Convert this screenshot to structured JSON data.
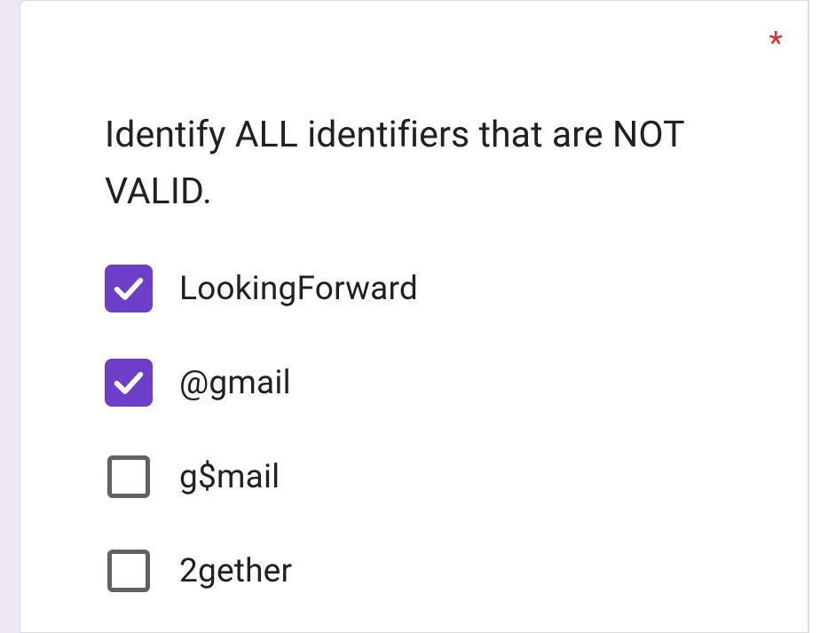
{
  "question": {
    "text": "Identify ALL identifiers that are NOT VALID.",
    "required_marker": "*",
    "options": [
      {
        "label": "LookingForward",
        "checked": true
      },
      {
        "label": "@gmail",
        "checked": true
      },
      {
        "label": "g$mail",
        "checked": false
      },
      {
        "label": "2gether",
        "checked": false
      }
    ]
  }
}
